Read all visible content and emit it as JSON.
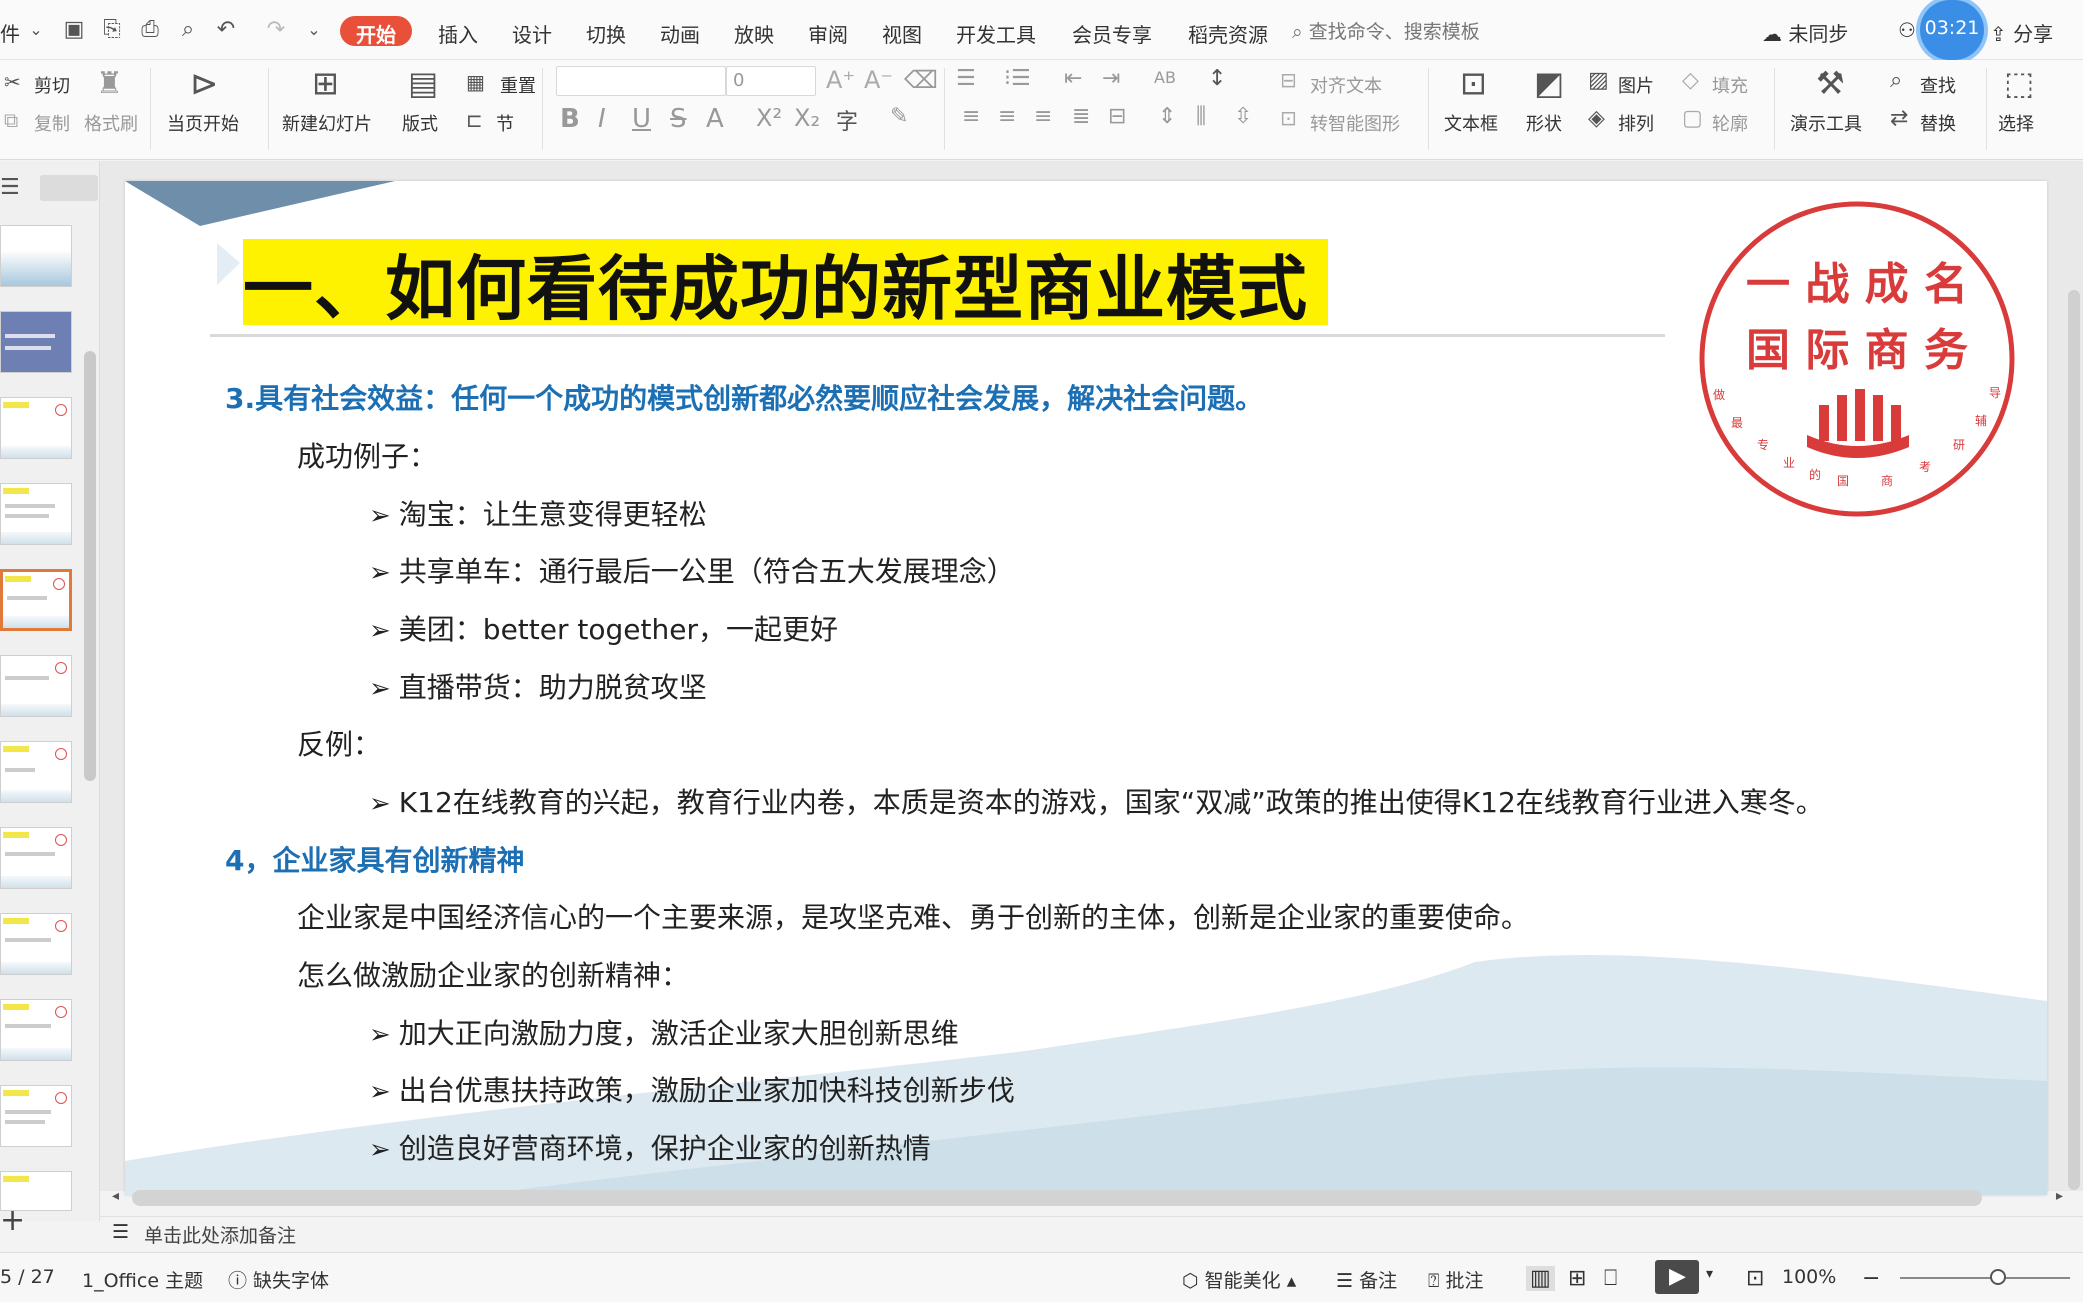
{
  "menubar": {
    "file_label": "件",
    "tabs": [
      "开始",
      "插入",
      "设计",
      "切换",
      "动画",
      "放映",
      "审阅",
      "视图",
      "开发工具",
      "会员专享",
      "稻壳资源"
    ],
    "search_placeholder": "查找命令、搜索模板",
    "sync_label": "未同步",
    "share_label": "分享",
    "timer": "03:21"
  },
  "toolbar": {
    "cut": "剪切",
    "copy": "复制",
    "format_painter": "格式刷",
    "play_from_current": "当页开始",
    "new_slide": "新建幻灯片",
    "layout": "版式",
    "reset": "重置",
    "section": "节",
    "font_size": "0",
    "align_text": "对齐文本",
    "to_smartart": "转智能图形",
    "textbox": "文本框",
    "shape": "形状",
    "picture": "图片",
    "arrange": "排列",
    "fill": "填充",
    "outline": "轮廓",
    "present_tools": "演示工具",
    "find": "查找",
    "replace": "替换",
    "select": "选择"
  },
  "slide": {
    "title": "一、如何看待成功的新型商业模式",
    "heading1": "3.具有社会效益：任何一个成功的模式创新都必然要顺应社会发展，解决社会问题。",
    "success_label": "成功例子：",
    "success_items": [
      "淘宝：让生意变得更轻松",
      "共享单车：通行最后一公里（符合五大发展理念）",
      "美团：better together，一起更好",
      "直播带货：助力脱贫攻坚"
    ],
    "counter_label": "反例：",
    "counter_items": [
      "K12在线教育的兴起，教育行业内卷，本质是资本的游戏，国家“双减”政策的推出使得K12在线教育行业进入寒冬。"
    ],
    "heading2": "4，企业家具有创新精神",
    "para1": "企业家是中国经济信心的一个主要来源，是攻坚克难、勇于创新的主体，创新是企业家的重要使命。",
    "para2": "怎么做激励企业家的创新精神：",
    "incentive_items": [
      "加大正向激励力度，激活企业家大胆创新思维",
      "出台优惠扶持政策，激励企业家加快科技创新步伐",
      "创造良好营商环境，保护企业家的创新热情"
    ],
    "stamp": {
      "line1": "一 战 成 名",
      "line2": "国 际 商 务",
      "ring_text": [
        "做",
        "最",
        "专",
        "业",
        "的",
        "国",
        "商",
        "考",
        "研",
        "辅",
        "导"
      ]
    }
  },
  "notes_placeholder": "单击此处添加备注",
  "status": {
    "page": "5 / 27",
    "theme": "1_Office 主题",
    "missing_font": "缺失字体",
    "beautify": "智能美化",
    "notes": "备注",
    "comment": "批注",
    "zoom": "100%"
  },
  "colors": {
    "accent_tab": "#e8503a",
    "title_highlight": "#fff200",
    "heading_blue": "#1c6fb3",
    "stamp_red": "#d93a3a"
  }
}
